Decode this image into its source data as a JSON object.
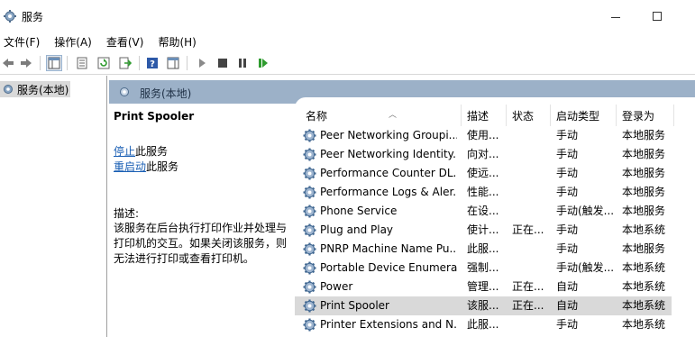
{
  "window": {
    "title": "服务"
  },
  "menu": [
    "文件(F)",
    "操作(A)",
    "查看(V)",
    "帮助(H)"
  ],
  "toolbar_icons": [
    "back-arrow-icon",
    "forward-arrow-icon",
    "console-tree-icon",
    "properties-icon",
    "refresh-icon",
    "export-list-icon",
    "help-icon",
    "show-hide-action-pane-icon",
    "start-service-icon",
    "stop-service-icon",
    "pause-service-icon",
    "restart-service-icon"
  ],
  "tree": {
    "item": "服务(本地)"
  },
  "header": {
    "label": "服务(本地)"
  },
  "details": {
    "service_name": "Print Spooler",
    "stop_link": "停止",
    "stop_suffix": "此服务",
    "restart_link": "重启动",
    "restart_suffix": "此服务",
    "desc_label": "描述:",
    "description": "该服务在后台执行打印作业并处理与打印机的交互。如果关闭该服务，则无法进行打印或查看打印机。"
  },
  "columns": {
    "name": "名称",
    "desc": "描述",
    "status": "状态",
    "startup": "启动类型",
    "logon": "登录为"
  },
  "services": [
    {
      "name": "Peer Networking Groupi...",
      "desc": "使用...",
      "status": "",
      "startup": "手动",
      "logon": "本地服务"
    },
    {
      "name": "Peer Networking Identity...",
      "desc": "向对...",
      "status": "",
      "startup": "手动",
      "logon": "本地服务"
    },
    {
      "name": "Performance Counter DL...",
      "desc": "使远...",
      "status": "",
      "startup": "手动",
      "logon": "本地服务"
    },
    {
      "name": "Performance Logs & Aler...",
      "desc": "性能...",
      "status": "",
      "startup": "手动",
      "logon": "本地服务"
    },
    {
      "name": "Phone Service",
      "desc": "在设...",
      "status": "",
      "startup": "手动(触发...",
      "logon": "本地服务"
    },
    {
      "name": "Plug and Play",
      "desc": "使计...",
      "status": "正在...",
      "startup": "手动",
      "logon": "本地系统"
    },
    {
      "name": "PNRP Machine Name Pu...",
      "desc": "此服...",
      "status": "",
      "startup": "手动",
      "logon": "本地服务"
    },
    {
      "name": "Portable Device Enumera...",
      "desc": "强制...",
      "status": "",
      "startup": "手动(触发...",
      "logon": "本地系统"
    },
    {
      "name": "Power",
      "desc": "管理...",
      "status": "正在...",
      "startup": "自动",
      "logon": "本地系统"
    },
    {
      "name": "Print Spooler",
      "desc": "该服...",
      "status": "正在...",
      "startup": "自动",
      "logon": "本地系统"
    },
    {
      "name": "Printer Extensions and N...",
      "desc": "此服...",
      "status": "",
      "startup": "手动",
      "logon": "本地系统"
    }
  ],
  "selected_index": 9,
  "colors": {
    "header_strip": "#9cb1c8",
    "selection": "#d9d9d9",
    "link": "#1a5fb4"
  }
}
